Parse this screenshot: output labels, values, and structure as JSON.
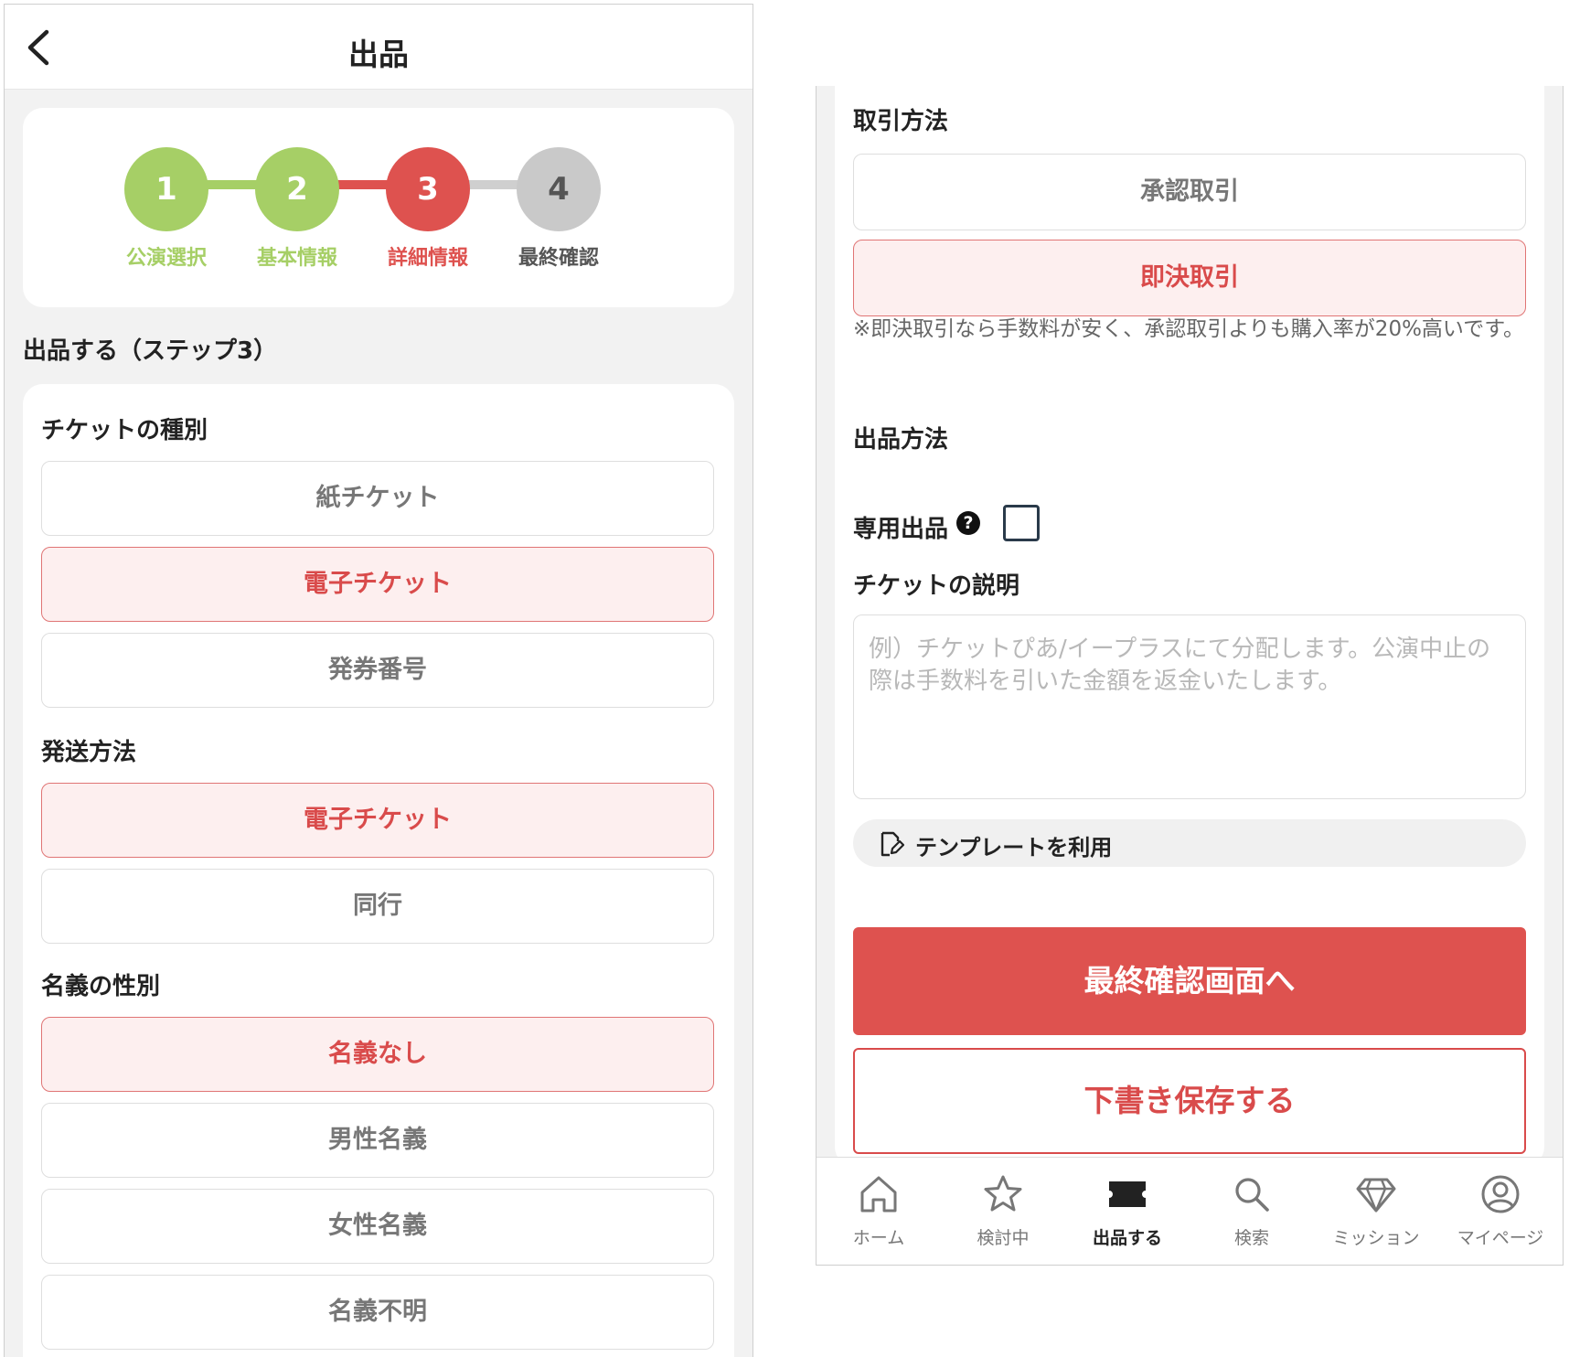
{
  "header": {
    "title": "出品"
  },
  "stepper": {
    "steps": [
      {
        "number": "1",
        "label": "公演選択",
        "state": "done"
      },
      {
        "number": "2",
        "label": "基本情報",
        "state": "done"
      },
      {
        "number": "3",
        "label": "詳細情報",
        "state": "current"
      },
      {
        "number": "4",
        "label": "最終確認",
        "state": "todo"
      }
    ],
    "colors": {
      "done": "#a6cf66",
      "current": "#de524f",
      "todo": "#c9c9c9"
    }
  },
  "section_title": "出品する（ステップ3）",
  "ticket_type": {
    "label": "チケットの種別",
    "options": [
      "紙チケット",
      "電子チケット",
      "発券番号"
    ],
    "selected": "電子チケット"
  },
  "shipping": {
    "label": "発送方法",
    "options": [
      "電子チケット",
      "同行"
    ],
    "selected": "電子チケット"
  },
  "name_gender": {
    "label": "名義の性別",
    "options": [
      "名義なし",
      "男性名義",
      "女性名義",
      "名義不明"
    ],
    "selected": "名義なし"
  },
  "trade_method": {
    "label": "取引方法",
    "options": [
      "承認取引",
      "即決取引"
    ],
    "selected": "即決取引",
    "note": "※即決取引なら手数料が安く、承認取引よりも購入率が20%高いです。"
  },
  "listing_method": {
    "label": "出品方法",
    "exclusive_label": "専用出品",
    "help_icon": "?",
    "exclusive_checked": false
  },
  "description": {
    "label": "チケットの説明",
    "placeholder": "例）チケットぴあ/イープラスにて分配します。公演中止の際は手数料を引いた金額を返金いたします。"
  },
  "template_button": {
    "label": "テンプレートを利用",
    "icon": "template-edit-icon"
  },
  "confirm_button": {
    "label": "最終確認画面へ"
  },
  "draft_button": {
    "label": "下書き保存する"
  },
  "tabbar": {
    "items": [
      {
        "label": "ホーム",
        "icon": "home-icon",
        "active": false
      },
      {
        "label": "検討中",
        "icon": "star-icon",
        "active": false
      },
      {
        "label": "出品する",
        "icon": "ticket-icon",
        "active": true
      },
      {
        "label": "検索",
        "icon": "search-icon",
        "active": false
      },
      {
        "label": "ミッション",
        "icon": "diamond-icon",
        "active": false
      },
      {
        "label": "マイページ",
        "icon": "user-icon",
        "active": false
      }
    ]
  },
  "colors": {
    "accent": "#de524f",
    "selected_bg": "#fdefef",
    "page_bg": "#f2f2f2"
  }
}
